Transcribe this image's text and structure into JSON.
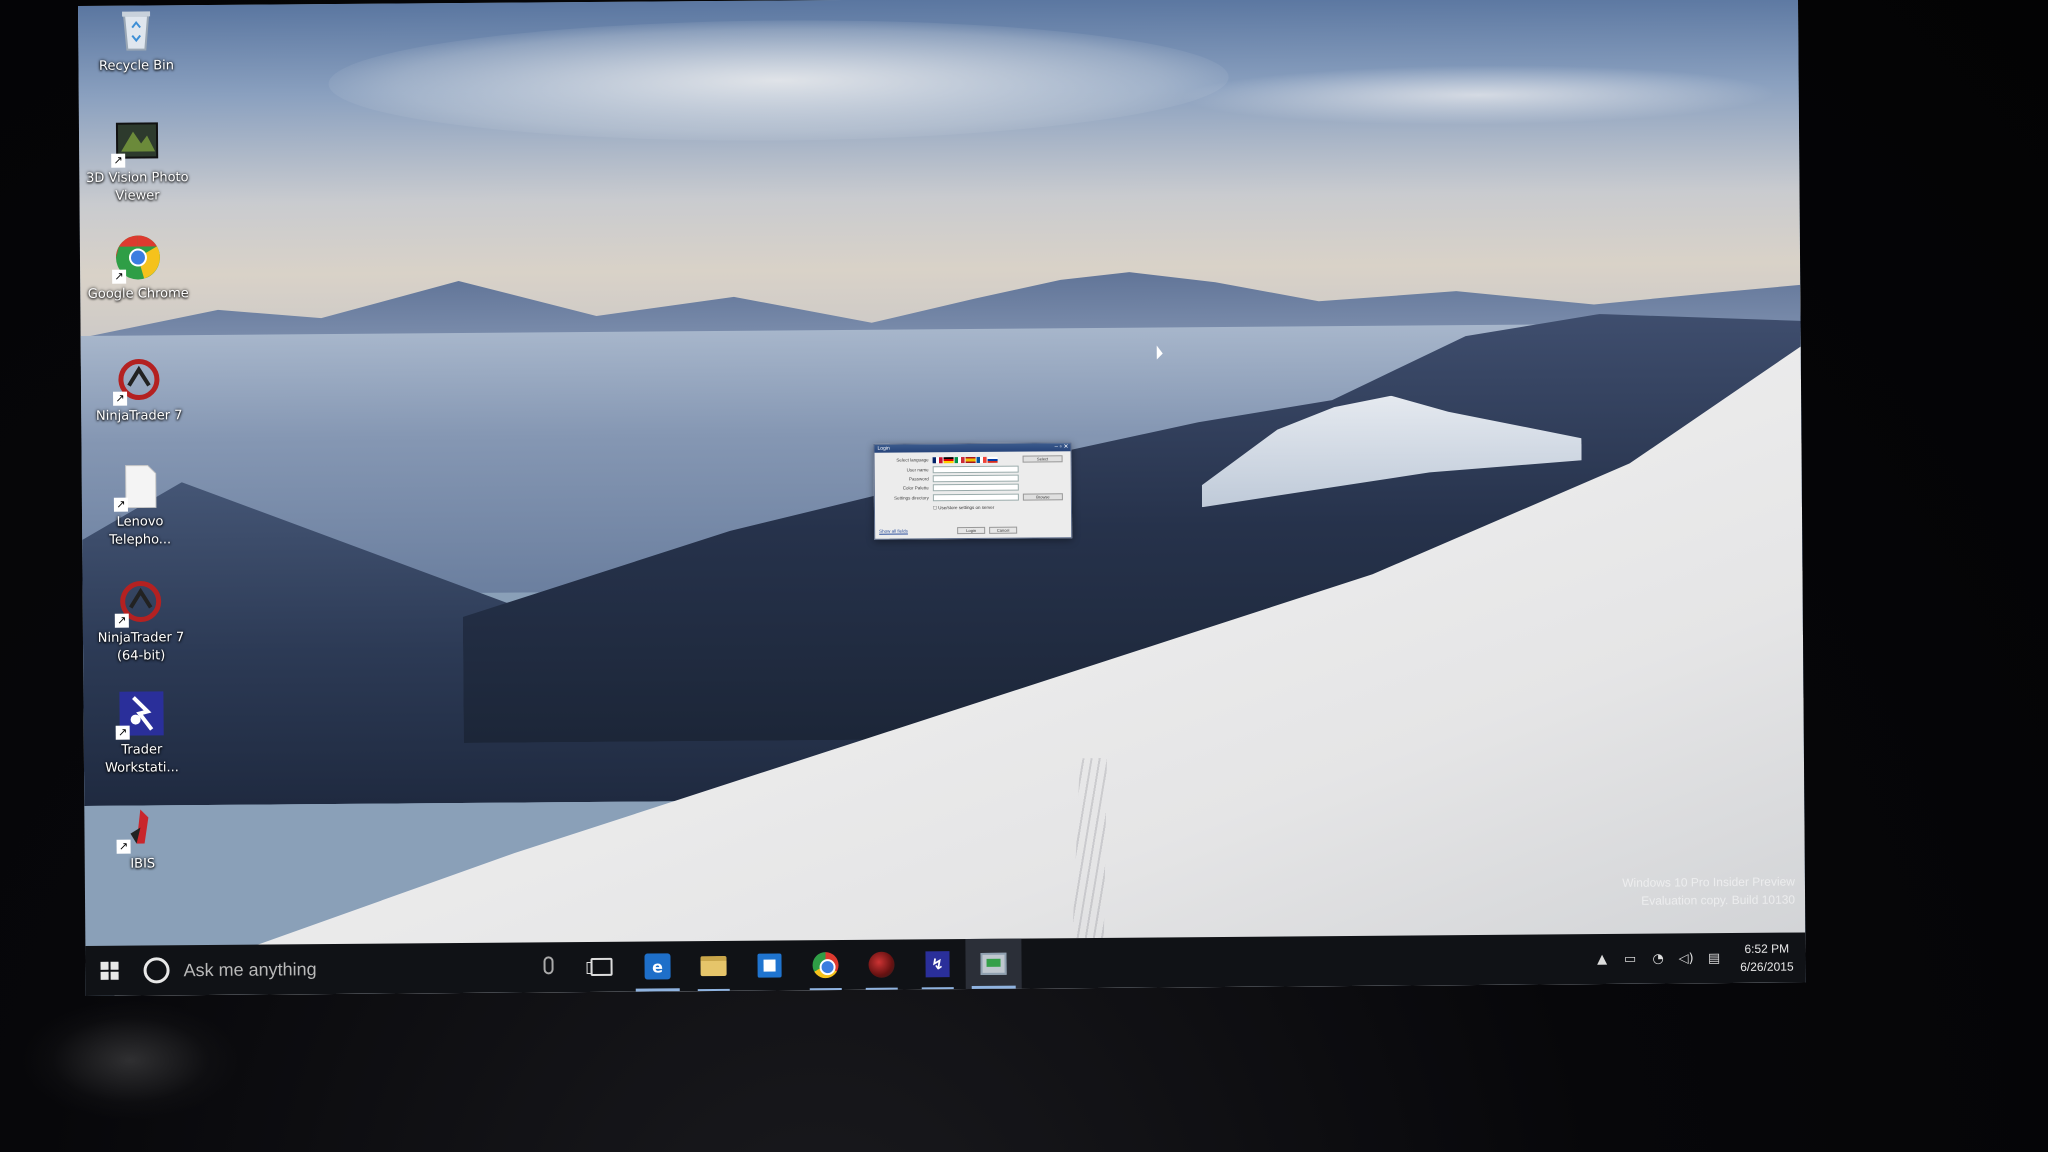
{
  "desktop": {
    "icons": [
      {
        "label": "Recycle Bin",
        "icon": "recycle-bin-icon"
      },
      {
        "label": "3D Vision Photo Viewer",
        "icon": "3d-vision-photo-viewer-icon"
      },
      {
        "label": "Google Chrome",
        "icon": "google-chrome-icon"
      },
      {
        "label": "NinjaTrader 7",
        "icon": "ninjatrader-icon"
      },
      {
        "label": "Lenovo Telepho...",
        "icon": "document-icon"
      },
      {
        "label": "NinjaTrader 7 (64-bit)",
        "icon": "ninjatrader-icon"
      },
      {
        "label": "Trader Workstati...",
        "icon": "trader-workstation-icon"
      },
      {
        "label": "IBIS",
        "icon": "ibis-icon"
      }
    ]
  },
  "login_dialog": {
    "title": "Login",
    "rows": [
      {
        "label": "Select language",
        "value": "",
        "button": "Select"
      },
      {
        "label": "User name",
        "value": "",
        "button": ""
      },
      {
        "label": "Password",
        "value": "",
        "button": ""
      },
      {
        "label": "Color Palette",
        "value": "",
        "button": ""
      },
      {
        "label": "Settings directory",
        "value": "",
        "button": "Browse"
      }
    ],
    "checkbox_label": "Use/store settings on server",
    "link": "Show all fields",
    "login_button": "Login",
    "cancel_button": "Cancel"
  },
  "watermark": {
    "line1": "Windows 10 Pro Insider Preview",
    "line2": "Evaluation copy. Build 10130"
  },
  "taskbar": {
    "search_placeholder": "Ask me anything",
    "apps": [
      {
        "name": "task-view",
        "icon": "task-view-icon"
      },
      {
        "name": "edge",
        "icon": "edge-icon"
      },
      {
        "name": "file-explorer",
        "icon": "folder-icon"
      },
      {
        "name": "store",
        "icon": "store-icon"
      },
      {
        "name": "chrome",
        "icon": "google-chrome-icon"
      },
      {
        "name": "ninjatrader",
        "icon": "ninjatrader-icon"
      },
      {
        "name": "trader-workstation",
        "icon": "trader-workstation-icon"
      },
      {
        "name": "login-app",
        "icon": "login-app-icon"
      }
    ],
    "clock_time": "6:52 PM",
    "clock_date": "6/26/2015"
  }
}
